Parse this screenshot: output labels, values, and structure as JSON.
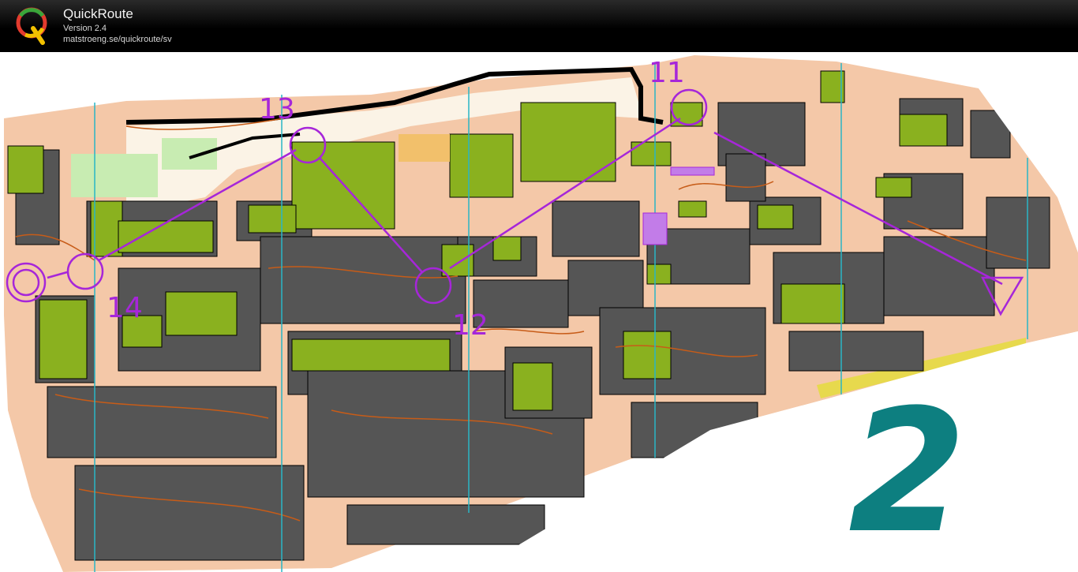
{
  "app": {
    "name": "QuickRoute",
    "version": "Version 2.4",
    "url": "matstroeng.se/quickroute/sv"
  },
  "map": {
    "map_number": "2",
    "course_color": "#a626d9",
    "north_line_color": "#29b6c6",
    "controls": [
      {
        "label": "11"
      },
      {
        "label": "12"
      },
      {
        "label": "13"
      },
      {
        "label": "14"
      }
    ]
  },
  "colors": {
    "background_paved": "#f4c8a8",
    "building": "#555555",
    "vegetation": "#8ab11f",
    "contour": "#c75c18",
    "map_number": "#0d7f80"
  },
  "icons": {
    "logo": "quickroute-q-logo"
  }
}
